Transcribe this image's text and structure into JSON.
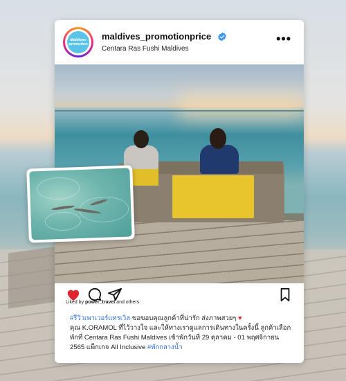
{
  "post": {
    "username": "maldives_promotionprice",
    "location": "Centara Ras Fushi Maldives",
    "avatar_text": [
      "Maldives",
      "promotion"
    ],
    "liked_by_prefix": "Liked by",
    "liked_by_user": "power_travel",
    "liked_by_suffix": "and others",
    "caption_lines": [
      {
        "tag": "#รีวิวเพาเวอร์แทรเวิล",
        "text": " ขอขอบคุณลูกค้าที่น่ารัก ส่งภาพสวยๆ",
        "heart": "♥"
      },
      {
        "text": "คุณ K.ORAMOL ที่ไว้วางใจ และให้ทางเราดูแลการเดินทางในครั้งนี้ ลูกค้าเลือก"
      },
      {
        "text": "พักที่ Centara Ras Fushi Maldives เข้าพักวันที่ 29 ตุลาคม - 01 พฤศจิกายน"
      },
      {
        "text": "2565 แพ็กเกจ All Inclusive ",
        "tag": "#พักกลางน้ำ"
      }
    ]
  },
  "icons": {
    "verified": "verified-badge-icon",
    "more": "more-options-icon",
    "like": "heart-icon",
    "comment": "comment-icon",
    "share": "share-icon",
    "save": "bookmark-icon"
  },
  "colors": {
    "like": "#e0262f",
    "hashtag": "#2f6fd6",
    "verified": "#3897f0"
  }
}
